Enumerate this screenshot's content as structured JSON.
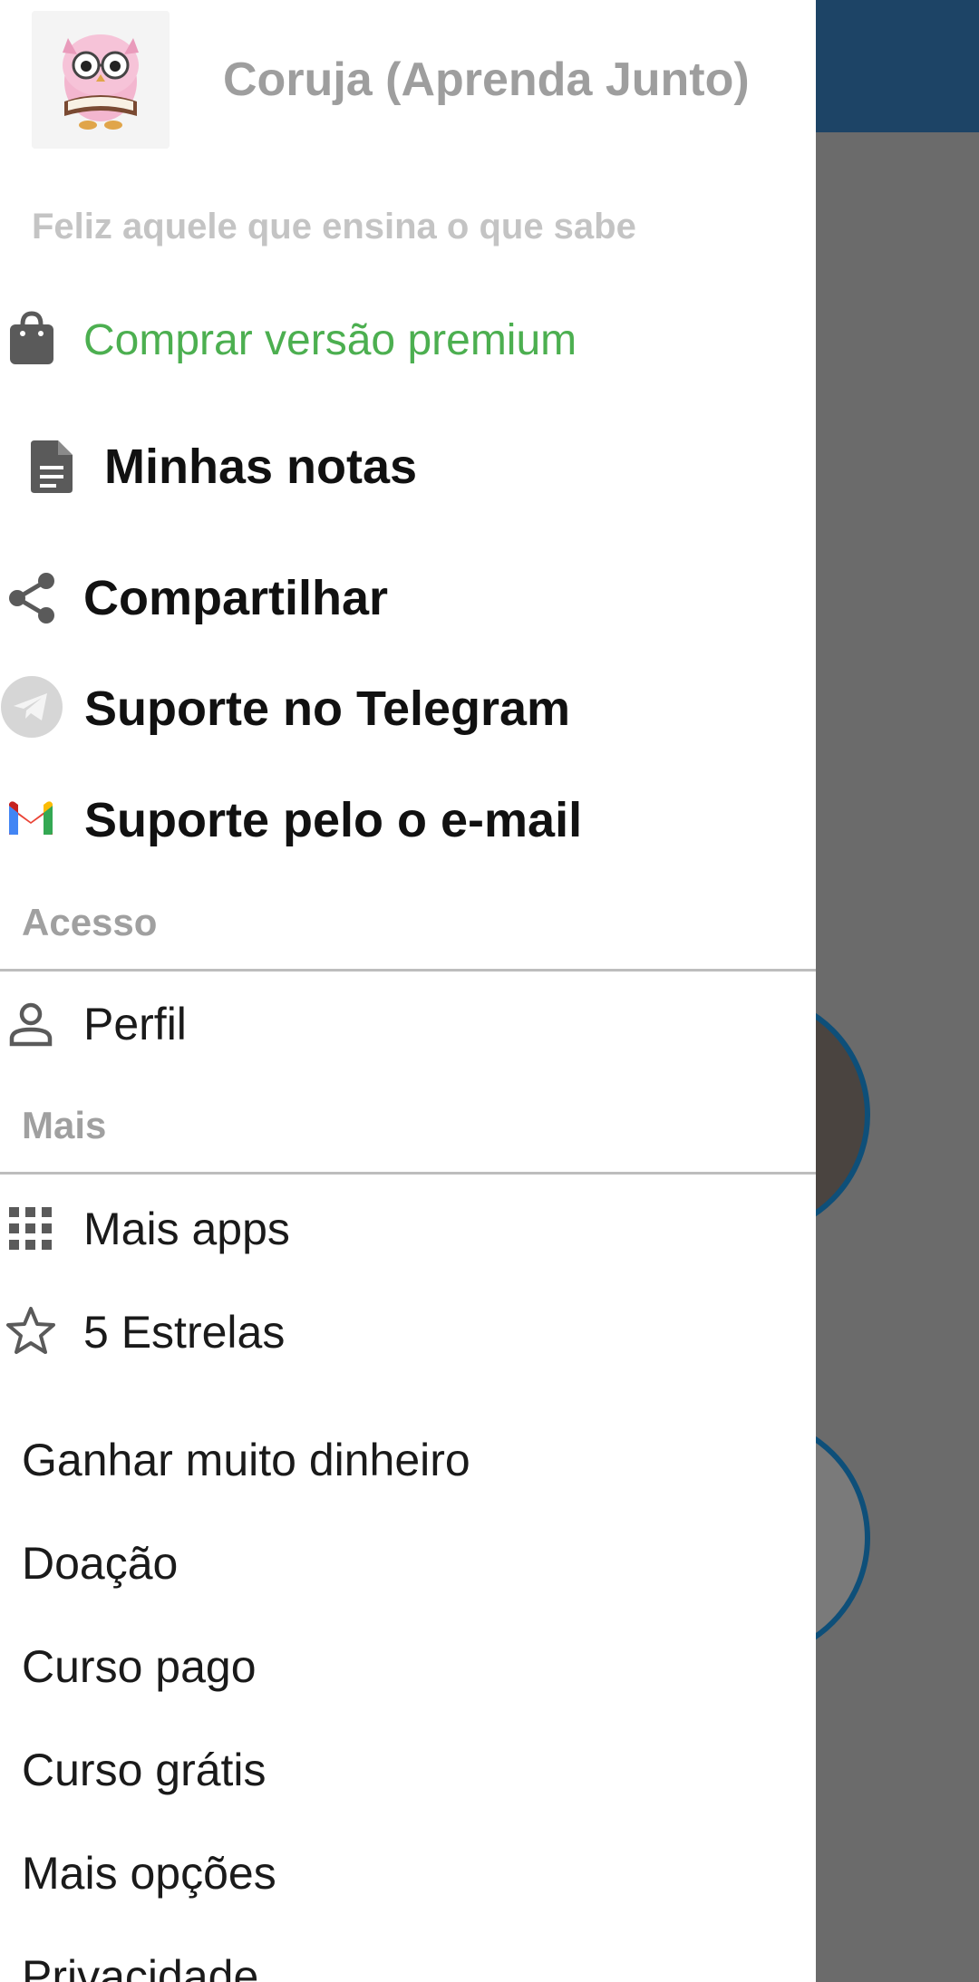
{
  "drawer": {
    "app_title": "Coruja (Aprenda Junto)",
    "tagline": "Feliz aquele que ensina o que sabe",
    "logo_icon": "owl-reading-book-icon",
    "primary_items": [
      {
        "label": "Comprar versão premium",
        "icon": "shopping-bag-icon",
        "color": "#4caf50"
      },
      {
        "label": "Minhas notas",
        "icon": "document-icon"
      },
      {
        "label": "Compartilhar",
        "icon": "share-icon"
      },
      {
        "label": "Suporte no Telegram",
        "icon": "telegram-icon"
      },
      {
        "label": "Suporte pelo o e-mail",
        "icon": "gmail-icon"
      }
    ],
    "sections": [
      {
        "title": "Acesso",
        "items": [
          {
            "label": "Perfil",
            "icon": "person-icon"
          }
        ]
      },
      {
        "title": "Mais",
        "items": [
          {
            "label": "Mais apps",
            "icon": "apps-grid-icon"
          },
          {
            "label": "5 Estrelas",
            "icon": "star-outline-icon"
          }
        ]
      }
    ],
    "plain_items": [
      "Ganhar muito dinheiro",
      "Doação",
      "Curso pago",
      "Curso grátis",
      "Mais opções",
      "Privacidade"
    ]
  },
  "colors": {
    "topbar": "#1d4466",
    "scrim": "#6b6b6b",
    "accent_green": "#4caf50",
    "section_gray": "#a0a0a0"
  }
}
